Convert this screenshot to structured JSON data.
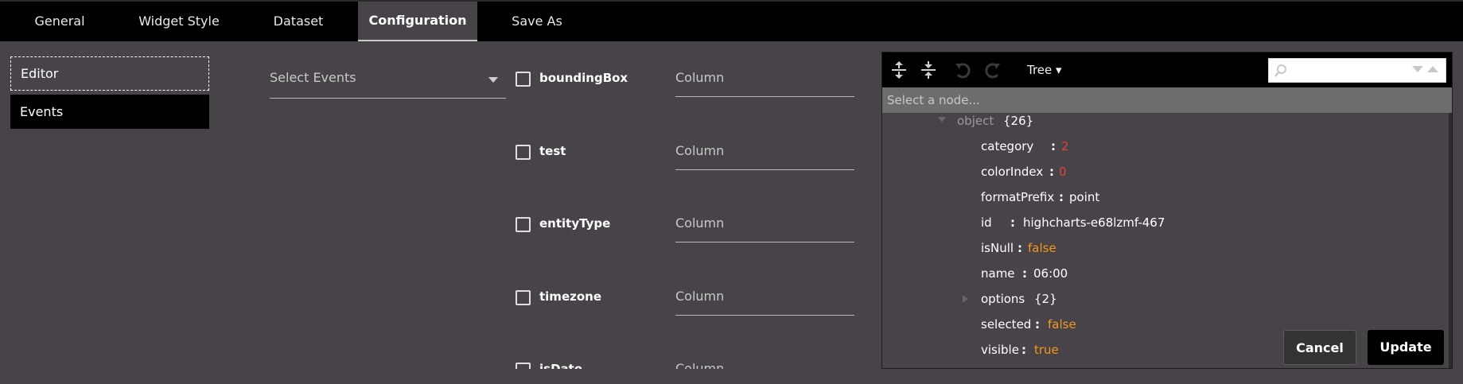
{
  "tabs": [
    {
      "label": "General",
      "active": false
    },
    {
      "label": "Widget Style",
      "active": false
    },
    {
      "label": "Dataset",
      "active": false
    },
    {
      "label": "Configuration",
      "active": true
    },
    {
      "label": "Save As",
      "active": false
    }
  ],
  "sidebar": {
    "items": [
      {
        "label": "Editor",
        "selected": false
      },
      {
        "label": "Events",
        "selected": true
      }
    ]
  },
  "events_select": {
    "placeholder": "Select Events"
  },
  "fields": [
    {
      "name": "boundingBox",
      "checked": false,
      "column_placeholder": "Column"
    },
    {
      "name": "test",
      "checked": false,
      "column_placeholder": "Column"
    },
    {
      "name": "entityType",
      "checked": false,
      "column_placeholder": "Column"
    },
    {
      "name": "timezone",
      "checked": false,
      "column_placeholder": "Column"
    },
    {
      "name": "isDate",
      "checked": false,
      "column_placeholder": "Column"
    }
  ],
  "tree_editor": {
    "toolbar": {
      "expand_all_icon": "expand-all-icon",
      "collapse_all_icon": "collapse-all-icon",
      "undo_icon": "undo-icon",
      "redo_icon": "redo-icon",
      "mode_label": "Tree ▾"
    },
    "node_search_placeholder": "Select a node...",
    "root": {
      "key": "object",
      "count": "{26}"
    },
    "nodes": [
      {
        "key": "category",
        "sep": ":",
        "value": "2",
        "type": "num"
      },
      {
        "key": "colorIndex",
        "sep": ":",
        "value": "0",
        "type": "num"
      },
      {
        "key": "formatPrefix",
        "sep": ":",
        "value": "point",
        "type": "str"
      },
      {
        "key": "id",
        "sep": ":",
        "value": "highcharts-e68lzmf-467",
        "type": "str"
      },
      {
        "key": "isNull",
        "sep": ":",
        "value": "false",
        "type": "bool"
      },
      {
        "key": "name",
        "sep": ":",
        "value": "06:00",
        "type": "str"
      },
      {
        "key": "options",
        "sep": "",
        "value": "{2}",
        "type": "cnt",
        "expandable": true
      },
      {
        "key": "selected",
        "sep": ":",
        "value": "false",
        "type": "bool"
      },
      {
        "key": "visible",
        "sep": ":",
        "value": "true",
        "type": "bool"
      }
    ]
  },
  "actions": {
    "cancel_label": "Cancel",
    "update_label": "Update"
  },
  "colors": {
    "background": "#474349",
    "tabbar": "#000000",
    "number_value": "#e8413a",
    "boolean_value": "#f39a1a"
  }
}
